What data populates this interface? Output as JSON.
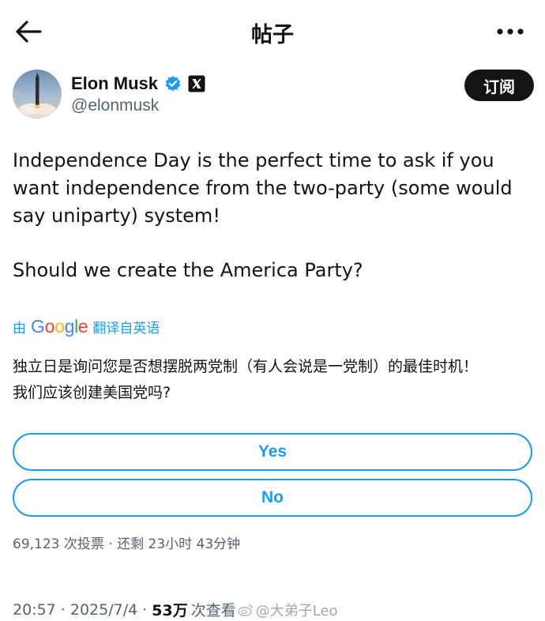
{
  "header": {
    "title": "帖子"
  },
  "author": {
    "name": "Elon Musk",
    "handle": "@elonmusk",
    "subscribe_label": "订阅"
  },
  "tweet": {
    "text_p1": "Independence Day is the perfect time to ask if you want independence from the two-party (some would say uniparty) system!",
    "text_p2": "Should we create the America Party?"
  },
  "translation": {
    "prefix": "由",
    "provider": "Google",
    "suffix": "翻译自英语",
    "line1": "独立日是询问您是否想摆脱两党制（有人会说是一党制）的最佳时机！",
    "line2": "我们应该创建美国党吗?"
  },
  "poll": {
    "options": [
      "Yes",
      "No"
    ],
    "meta": "69,123 次投票 · 还剩 23小时 43分钟"
  },
  "footer": {
    "time_date": "20:57 · 2025/7/4 · ",
    "views_count": "53万",
    "views_label": "次查看",
    "watermark": "@大弟子Leo"
  },
  "colors": {
    "accent": "#1d9bf0",
    "text": "#0f1419",
    "muted": "#536471"
  }
}
